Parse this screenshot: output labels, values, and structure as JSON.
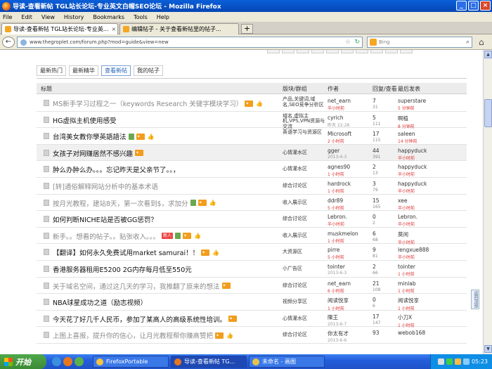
{
  "window": {
    "title": "导读-查看新帖 TGL站长论坛-专业英文白帽SEO论坛 - Mozilla Firefox"
  },
  "menu": [
    "File",
    "Edit",
    "View",
    "History",
    "Bookmarks",
    "Tools",
    "Help"
  ],
  "tabs": [
    {
      "label": "导读-查看新帖 TGL站长论坛-专业英...",
      "active": true
    },
    {
      "label": "编辑帖子 - 关于查看新帖里的帖子...",
      "active": false
    }
  ],
  "new_tab_label": "+",
  "url": "www.thegroplet.com/forum.php?mod=guide&view=new",
  "search_placeholder": "Bing",
  "subtabs": [
    "最新热门",
    "最新精华",
    "查看新帖",
    "我的帖子"
  ],
  "table_headers": {
    "subject": "标题",
    "forum": "版块/群组",
    "author": "作者",
    "replies": "回复/查看",
    "last_post": "最后发表"
  },
  "rows": [
    {
      "subject": "MS新手学习过程之一（keywords Research 关键字模块学习）",
      "dim": true,
      "badges": [
        "hot",
        "thumb"
      ],
      "forum": "产品,关键词,域名,SEO竞争分析区",
      "author": "net_earn",
      "author_time": "半小时前",
      "replies": "7",
      "views": "31",
      "last": "superstare",
      "last_time": "5 分钟前"
    },
    {
      "subject": "HG虚拟主机使用感受",
      "dim": false,
      "badges": [],
      "forum": "域名,虚拟主机,VPS,VPN资源与交流",
      "author": "cyrich",
      "author_time": "昨天 22:28",
      "replies": "5",
      "views": "111",
      "last": "啊植",
      "last_time": "8 分钟前"
    },
    {
      "subject": "台湾美女教你學英語語法",
      "dim": false,
      "badges": [
        "img",
        "hot",
        "thumb"
      ],
      "forum": "英语学习与资源区",
      "author": "Microsoft",
      "author_time": "2 小时前",
      "replies": "17",
      "views": "115",
      "last": "saleen",
      "last_time": "14 分钟前"
    },
    {
      "subject": "女孩子对网赚居然不感兴趣",
      "dim": false,
      "highlight": true,
      "badges": [
        "hot"
      ],
      "forum": "心情灌水区",
      "author": "gger",
      "author_time": "2013-4-3",
      "replies": "44",
      "views": "391",
      "last": "happyduck",
      "last_time": "半小时前"
    },
    {
      "subject": "肿么办肿么办。。。忘记昨天是父亲节了。。，",
      "dim": false,
      "badges": [],
      "forum": "心情灌水区",
      "author": "agnes90",
      "author_time": "1 小时前",
      "replies": "2",
      "views": "13",
      "last": "happyduck",
      "last_time": "半小时前"
    },
    {
      "subject": "[转]通俗解释网站分析中的基本术语",
      "dim": true,
      "badges": [],
      "forum": "综合讨论区",
      "author": "hardrock",
      "author_time": "1 小时前",
      "replies": "3",
      "views": "79",
      "last": "happyduck",
      "last_time": "半小时前"
    },
    {
      "subject": "按月光教程，建站8天，第一次看到$，求加分",
      "dim": true,
      "badges": [
        "img",
        "hot",
        "thumb"
      ],
      "forum": "收入展示区",
      "author": "ddr89",
      "author_time": "5 小时前",
      "replies": "15",
      "views": "165",
      "last": "xee",
      "last_time": "半小时前"
    },
    {
      "subject": "如何判断NICHE站是否被GG惩罚？",
      "dim": false,
      "badges": [],
      "forum": "综合讨论区",
      "author": "Lebron.",
      "author_time": "半小时前",
      "replies": "0",
      "views": "2",
      "last": "Lebron.",
      "last_time": "半小时前"
    },
    {
      "subject": "新手。。想看的帖子。。贴张收入。。。",
      "dim": true,
      "badges": [
        "new",
        "img",
        "hot",
        "thumb"
      ],
      "forum": "收入展示区",
      "author": "muskmelon",
      "author_time": "1 小时前",
      "replies": "6",
      "views": "68",
      "last": "莫闲",
      "last_time": "半小时前"
    },
    {
      "subject": "【翻译】如何永久免费试用market samurai！！",
      "dim": false,
      "badges": [
        "hot",
        "thumb"
      ],
      "forum": "大资源区",
      "author": "pirre",
      "author_time": "5 小时前",
      "replies": "9",
      "views": "81",
      "last": "lengxue888",
      "last_time": "半小时前"
    },
    {
      "subject": "香港服务器租用E5200 2G内存每月低至550元",
      "dim": false,
      "badges": [],
      "forum": "小广告区",
      "author": "tointer",
      "author_time": "2013-6-3",
      "replies": "2",
      "views": "66",
      "last": "tointer",
      "last_time": "1 小时前"
    },
    {
      "subject": "关于域名空间，通过这几天的学习，我推翻了原来的想法",
      "dim": true,
      "badges": [
        "hot"
      ],
      "forum": "综合讨论区",
      "author": "net_earn",
      "author_time": "6 小时前",
      "replies": "21",
      "views": "108",
      "last": "minlab",
      "last_time": "1 小时前"
    },
    {
      "subject": "NBA球星成功之道（励志视频）",
      "dim": false,
      "badges": [],
      "forum": "视频分享区",
      "author": "阅读悦享",
      "author_time": "1 小时前",
      "replies": "0",
      "views": "6",
      "last": "阅读悦享",
      "last_time": "1 小时前"
    },
    {
      "subject": "今天花了好几千人民币，参加了某高人的高级系统性培训。",
      "dim": false,
      "badges": [
        "hot"
      ],
      "forum": "心情灌水区",
      "author": "陳王",
      "author_time": "2013-6-7",
      "replies": "17",
      "views": "147",
      "last": "小刀X",
      "last_time": "1 小时前"
    },
    {
      "subject": "上图上喜报，提升你的信心，让月光教程帮你赚高赞把",
      "dim": true,
      "badges": [
        "hot",
        "thumb"
      ],
      "forum": "综合讨论区",
      "author": "你太有才",
      "author_time": "2013-6-6",
      "replies": "93",
      "views": "",
      "last": "webob168",
      "last_time": ""
    }
  ],
  "back_to_top": "返回顶部",
  "taskbar": {
    "start": "开始",
    "tasks": [
      {
        "label": "FirefoxPortable",
        "active": false
      },
      {
        "label": "导读-查看新帖 TG...",
        "active": true
      },
      {
        "label": "未命名 - 画图",
        "active": false
      }
    ],
    "clock": "05:23"
  },
  "colors": {
    "titlebar": "#0a5fd8",
    "accent_link": "#2361b8",
    "red_time": "#dd3333",
    "hot_badge": "#f29d1c"
  }
}
